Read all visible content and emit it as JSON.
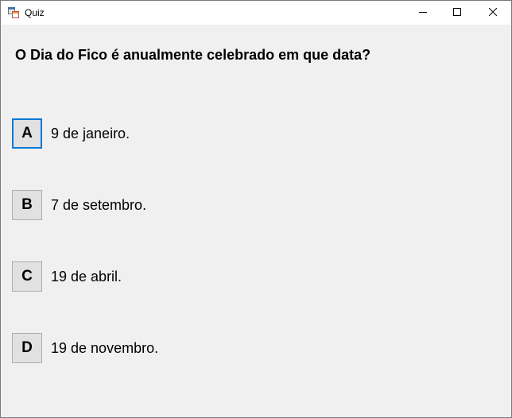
{
  "window": {
    "title": "Quiz",
    "app_icon": "form-app-icon",
    "controls": {
      "minimize_icon": "minimize-icon",
      "maximize_icon": "maximize-icon",
      "close_icon": "close-icon"
    }
  },
  "quiz": {
    "question": "O Dia do Fico é anualmente celebrado em que data?",
    "options": [
      {
        "letter": "A",
        "text": "9 de janeiro."
      },
      {
        "letter": "B",
        "text": "7 de setembro."
      },
      {
        "letter": "C",
        "text": "19 de abril."
      },
      {
        "letter": "D",
        "text": "19 de novembro."
      }
    ]
  },
  "colors": {
    "window_bg": "#f0f0f0",
    "button_bg": "#e1e1e1",
    "button_border": "#adadad",
    "focus_border": "#0078d7"
  }
}
